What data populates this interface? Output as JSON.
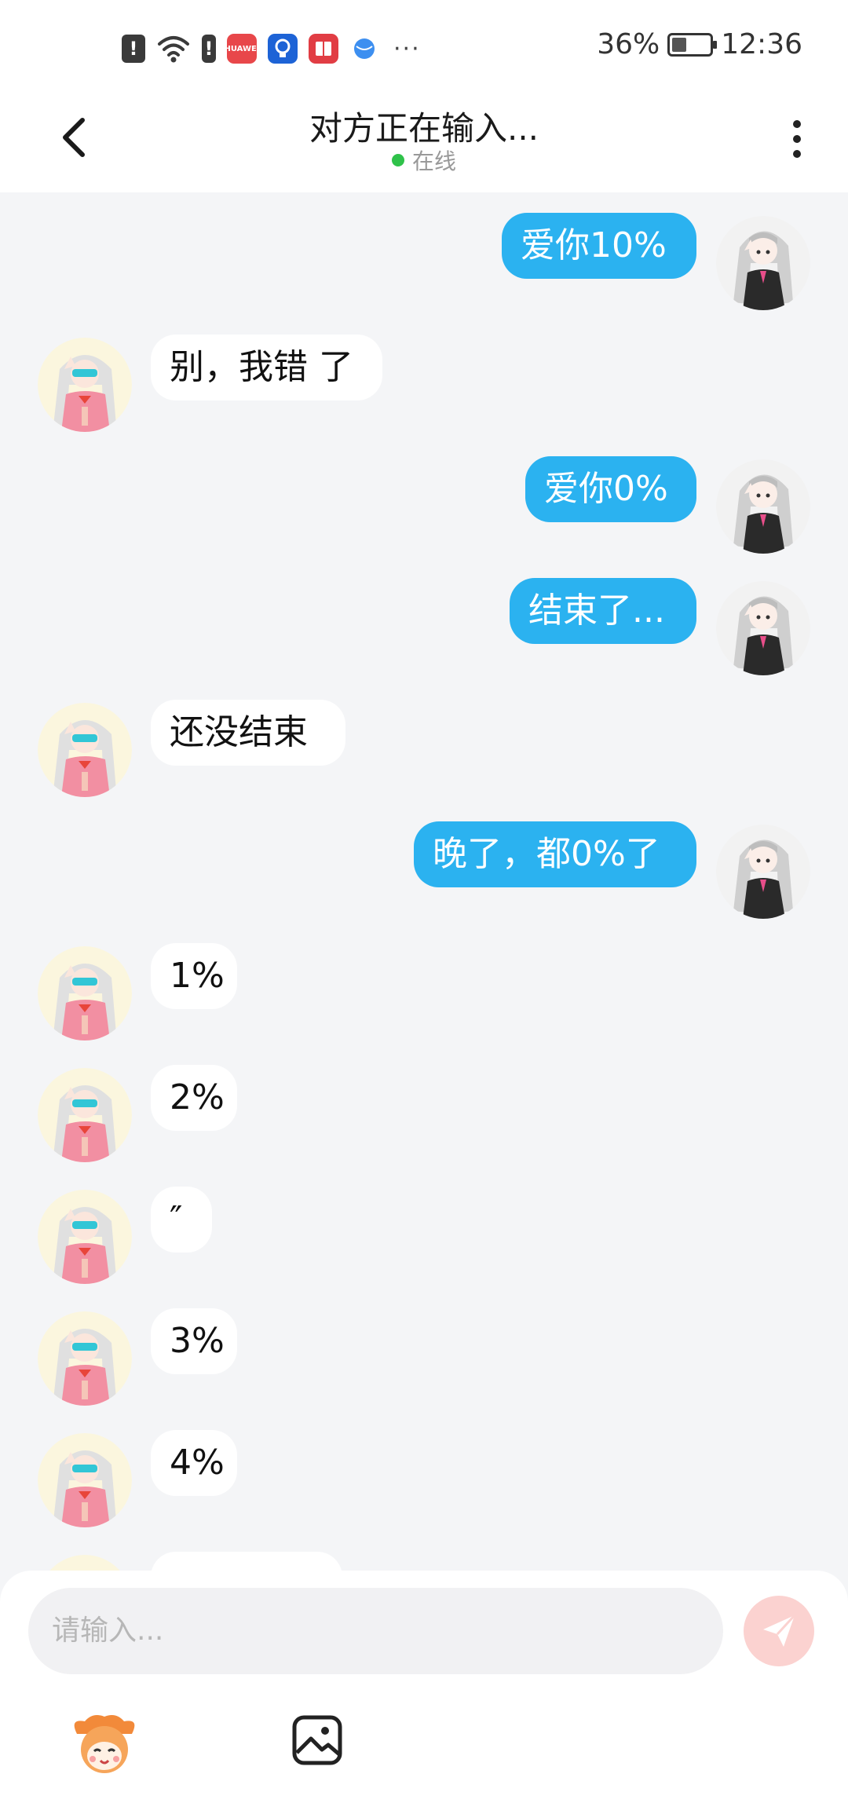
{
  "status_bar": {
    "battery_text": "36%",
    "time": "12:36",
    "notification_icons": [
      "alert-icon",
      "wifi-icon",
      "alert-icon",
      "huawei-appgallery-icon",
      "lightbulb-app-icon",
      "book-app-icon",
      "browser-icon"
    ],
    "huawei_text": "HUAWEI",
    "more": "···"
  },
  "header": {
    "title": "对方正在输入...",
    "status": "在线",
    "online_color": "#2fc24a"
  },
  "colors": {
    "outgoing_bubble": "#2bb2f0",
    "incoming_bubble": "#ffffff",
    "background": "#f4f5f7",
    "send_button": "#fbd2d0"
  },
  "messages": [
    {
      "side": "out",
      "text": "爱你10%"
    },
    {
      "side": "in",
      "text": "别，我错 了"
    },
    {
      "side": "out",
      "text": "爱你0%"
    },
    {
      "side": "out",
      "text": "结束了..."
    },
    {
      "side": "in",
      "text": "还没结束"
    },
    {
      "side": "out",
      "text": "晚了，都0%了"
    },
    {
      "side": "in",
      "text": "1%"
    },
    {
      "side": "in",
      "text": "2%"
    },
    {
      "side": "in",
      "text": "″"
    },
    {
      "side": "in",
      "text": "3%"
    },
    {
      "side": "in",
      "text": "4%"
    }
  ],
  "composer": {
    "placeholder": "请输入...",
    "send_icon": "send-icon",
    "mascot_icon": "mascot-icon",
    "image_icon": "image-icon"
  }
}
